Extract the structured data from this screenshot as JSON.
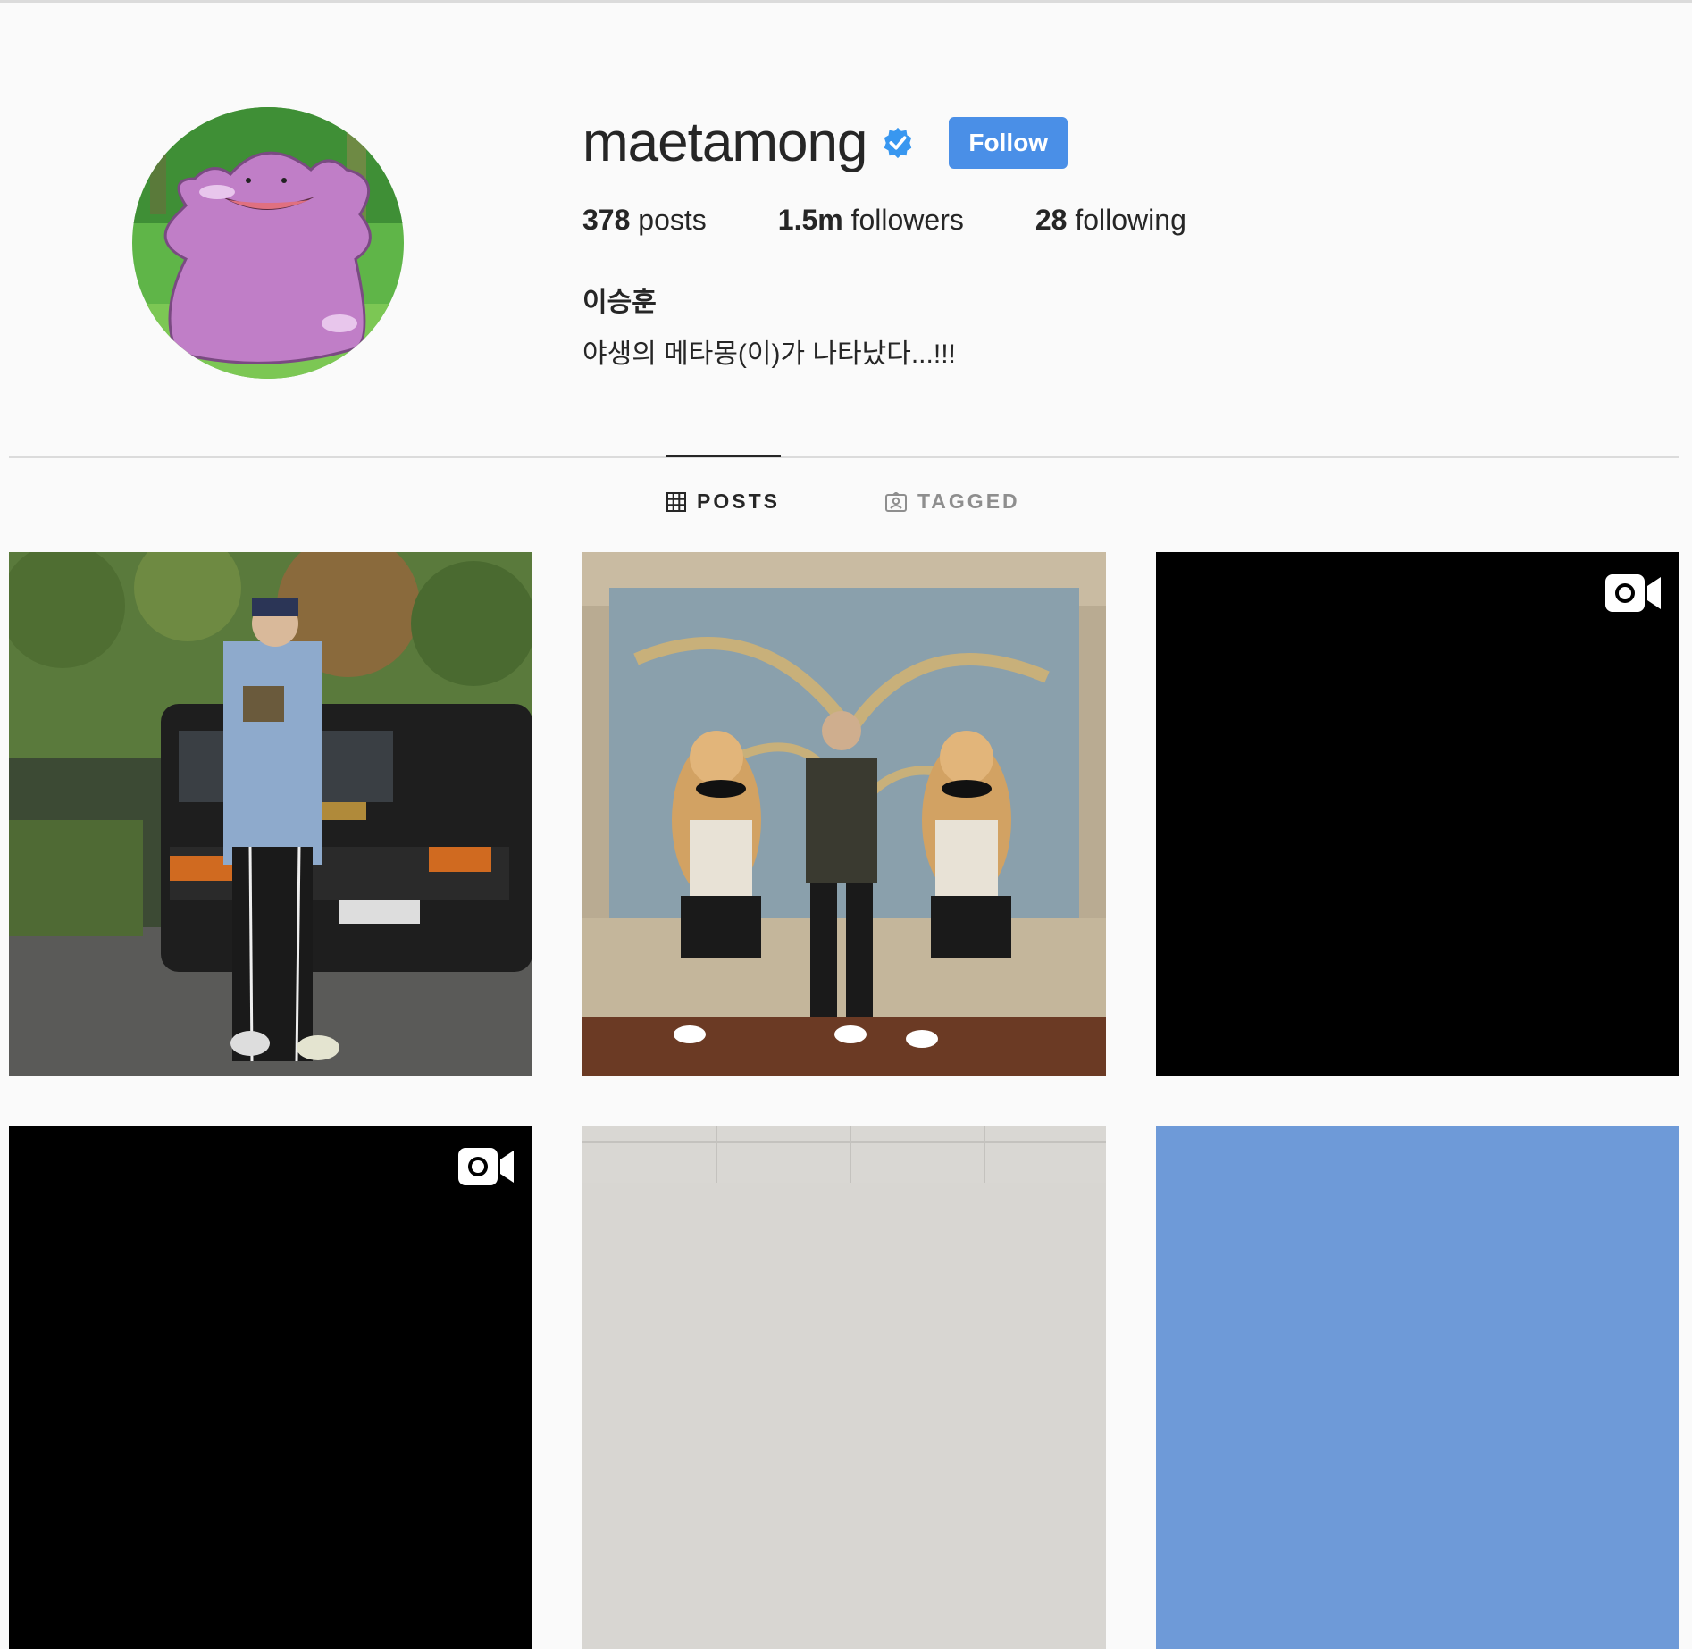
{
  "profile": {
    "username": "maetamong",
    "follow_label": "Follow",
    "posts_count": "378",
    "posts_label": " posts",
    "followers_count": "1.5m",
    "followers_label": " followers",
    "following_count": "28",
    "following_label": " following",
    "full_name": "이승훈",
    "bio": "야생의 메타몽(이)가 나타났다...!!!"
  },
  "tabs": [
    {
      "label": "POSTS",
      "icon": "grid-icon",
      "active": true
    },
    {
      "label": "TAGGED",
      "icon": "tagged-icon",
      "active": false
    }
  ],
  "colors": {
    "follow_button": "#4a8fe7",
    "verified_badge": "#3897f0",
    "background": "#fafafa"
  },
  "posts": [
    {
      "kind": "photo",
      "description": "man standing in front of black van"
    },
    {
      "kind": "photo",
      "description": "three men posing in front of leopard mural"
    },
    {
      "kind": "video",
      "icon": "video-icon"
    },
    {
      "kind": "video",
      "icon": "video-icon"
    },
    {
      "kind": "photo"
    },
    {
      "kind": "photo"
    }
  ]
}
